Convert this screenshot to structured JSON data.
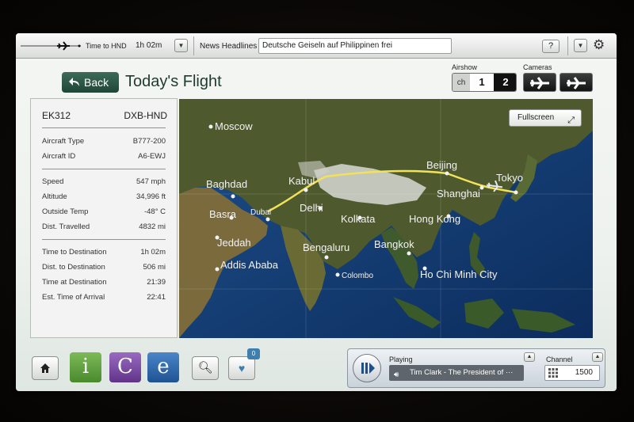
{
  "topbar": {
    "time_label": "Time to HND",
    "time_value": "1h 02m",
    "news_label": "News Headlines",
    "news_text": "Deutsche Geiseln auf Philippinen frei",
    "help_label": "?"
  },
  "header": {
    "back_label": "Back",
    "title": "Today's Flight",
    "airshow_label": "Airshow",
    "ch_label": "ch",
    "ch_options": [
      "1",
      "2"
    ],
    "ch_selected": "2",
    "cameras_label": "Cameras"
  },
  "flight": {
    "number": "EK312",
    "route": "DXB-HND",
    "group1": [
      {
        "label": "Aircraft Type",
        "value": "B777-200"
      },
      {
        "label": "Aircraft ID",
        "value": "A6-EWJ"
      }
    ],
    "group2": [
      {
        "label": "Speed",
        "value": "547 mph"
      },
      {
        "label": "Altitude",
        "value": "34,996 ft"
      },
      {
        "label": "Outside Temp",
        "value": "-48° C"
      },
      {
        "label": "Dist. Travelled",
        "value": "4832 mi"
      }
    ],
    "group3": [
      {
        "label": "Time to Destination",
        "value": "1h 02m"
      },
      {
        "label": "Dist. to Destination",
        "value": "506 mi"
      },
      {
        "label": "Time at Destination",
        "value": "21:39"
      },
      {
        "label": "Est. Time of Arrival",
        "value": "22:41"
      }
    ]
  },
  "map": {
    "fullscreen_label": "Fullscreen",
    "cities": [
      "Moscow",
      "Baghdad",
      "Kabul",
      "Beijing",
      "Tokyo",
      "Shanghai",
      "Basra",
      "Dubai",
      "Delhi",
      "Kolkata",
      "Hong Kong",
      "Jeddah",
      "Bengaluru",
      "Bangkok",
      "Addis Ababa",
      "Colombo",
      "Ho Chi Minh City"
    ]
  },
  "dock": {
    "apps": [
      "i",
      "C",
      "e"
    ],
    "favorites_count": "0"
  },
  "player": {
    "playing_label": "Playing",
    "track": "Tim Clark - The President of ···",
    "channel_label": "Channel",
    "channel_value": "1500"
  },
  "colors": {
    "route": "#f2e25a",
    "back_btn": "#2b5645",
    "app_i": "#5c9a3c",
    "app_c": "#7a4aa0",
    "app_e": "#2a64a8"
  }
}
